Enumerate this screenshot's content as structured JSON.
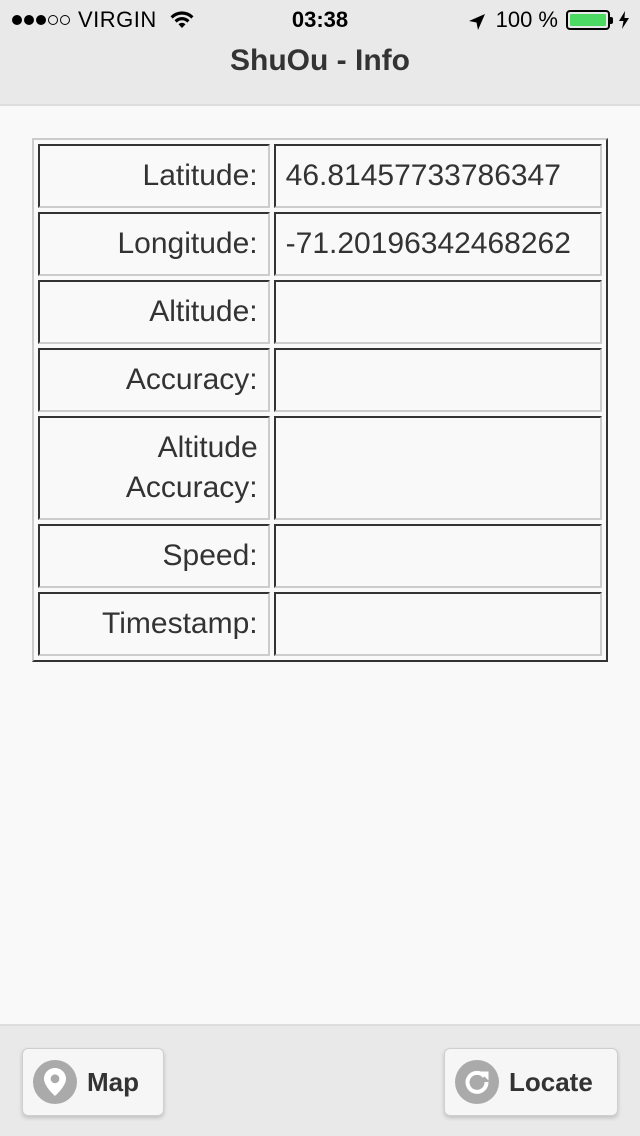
{
  "status_bar": {
    "carrier": "VIRGIN",
    "time": "03:38",
    "battery": "100 %",
    "signal_bars_filled": 3,
    "signal_bars_total": 5,
    "battery_level": 1.0,
    "battery_color": "#4cd964",
    "icons": [
      "wifi-icon",
      "location-arrow-icon",
      "battery-icon",
      "charging-icon"
    ]
  },
  "header": {
    "title": "ShuOu - Info"
  },
  "info_table": {
    "rows": [
      {
        "label": "Latitude:",
        "value": "46.81457733786347"
      },
      {
        "label": "Longitude:",
        "value": "-71.20196342468262"
      },
      {
        "label": "Altitude:",
        "value": ""
      },
      {
        "label": "Accuracy:",
        "value": ""
      },
      {
        "label": "Altitude\nAccuracy:",
        "value": ""
      },
      {
        "label": "Speed:",
        "value": ""
      },
      {
        "label": "Timestamp:",
        "value": ""
      }
    ]
  },
  "toolbar": {
    "map_label": "Map",
    "map_icon": "map-pin-icon",
    "locate_label": "Locate",
    "locate_icon": "refresh-icon"
  }
}
